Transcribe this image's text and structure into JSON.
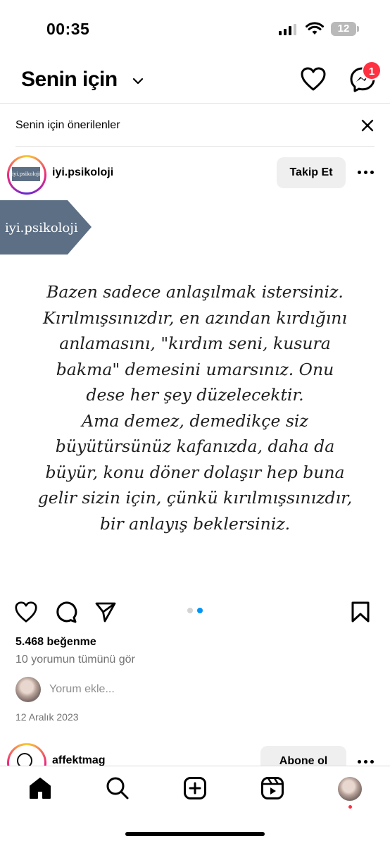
{
  "status_bar": {
    "time": "00:35",
    "battery": "12"
  },
  "header": {
    "title": "Senin için",
    "notification_count": "1"
  },
  "suggestions": {
    "label": "Senin için önerilenler"
  },
  "post": {
    "username": "iyi.psikoloji",
    "avatar_logo_text": "iyi.psikoloji",
    "follow_label": "Takip Et",
    "image": {
      "tag_text": "iyi.psikoloji",
      "quote_lines": [
        "Bazen sadece anlaşılmak istersiniz.",
        "Kırılmışsınızdır, en azından kırdığını",
        "anlamasını, \"kırdım seni, kusura",
        "bakma\" demesini umarsınız. Onu",
        "dese her şey düzelecektir.",
        "Ama demez, demedikçe siz",
        "büyütürsünüz kafanızda, daha da",
        "büyür, konu döner dolaşır hep buna",
        "gelir sizin için, çünkü kırılmışsınızdır,",
        "bir anlayış beklersiniz."
      ]
    },
    "carousel": {
      "total": 2,
      "active_index": 1
    },
    "likes": "5.468 beğenme",
    "view_comments": "10 yorumun tümünü gör",
    "comment_placeholder": "Yorum ekle...",
    "date": "12 Aralık 2023"
  },
  "next_post": {
    "username": "affektmag",
    "subscribe_label": "Abone ol"
  },
  "tabbar": {
    "items": [
      "home-icon",
      "search-icon",
      "new-post-icon",
      "reels-icon",
      "profile-avatar"
    ]
  },
  "colors": {
    "notification": "#ff3040",
    "accent": "#0095f6",
    "tag_bg": "#5d6f84",
    "secondary_text": "#737373"
  }
}
